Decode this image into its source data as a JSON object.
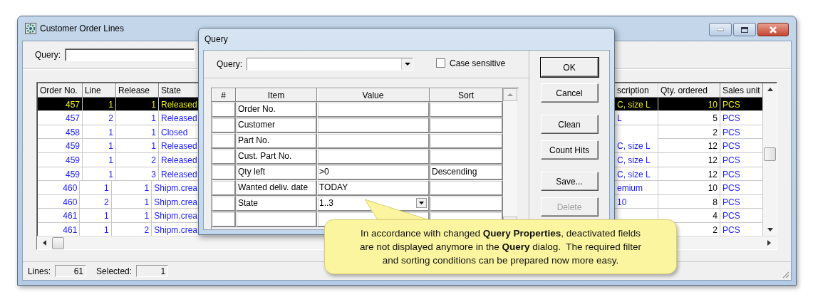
{
  "window": {
    "title": "Customer Order Lines"
  },
  "query_bar": {
    "label": "Query:"
  },
  "orders_table": {
    "left_columns": [
      "Order No.",
      "Line",
      "Release",
      "State"
    ],
    "right_columns": [
      "scription",
      "Qty. ordered",
      "Sales unit"
    ],
    "rows": [
      {
        "order_no": "457",
        "line": "1",
        "release": "1",
        "state": "Released",
        "description": "C, size L",
        "qty_ordered": "10",
        "sales_unit": "PCS",
        "selected": true
      },
      {
        "order_no": "457",
        "line": "2",
        "release": "1",
        "state": "Released",
        "description": "L",
        "qty_ordered": "5",
        "sales_unit": "PCS",
        "selected": false
      },
      {
        "order_no": "458",
        "line": "1",
        "release": "1",
        "state": "Closed",
        "qty_ordered": "2",
        "sales_unit": "PCS",
        "selected": false
      },
      {
        "order_no": "459",
        "line": "1",
        "release": "1",
        "state": "Released",
        "description": "C, size L",
        "qty_ordered": "12",
        "sales_unit": "PCS",
        "selected": false
      },
      {
        "order_no": "459",
        "line": "1",
        "release": "2",
        "state": "Released",
        "description": "C, size L",
        "qty_ordered": "12",
        "sales_unit": "PCS",
        "selected": false
      },
      {
        "order_no": "459",
        "line": "1",
        "release": "3",
        "state": "Released",
        "description": "C, size L",
        "qty_ordered": "12",
        "sales_unit": "PCS",
        "selected": false
      },
      {
        "order_no": "460",
        "line": "1",
        "release": "1",
        "state": "Shipm.crea",
        "description": "emium",
        "qty_ordered": "10",
        "sales_unit": "PCS",
        "selected": false
      },
      {
        "order_no": "460",
        "line": "2",
        "release": "1",
        "state": "Shipm.crea",
        "description": "10",
        "qty_ordered": "8",
        "sales_unit": "PCS",
        "selected": false
      },
      {
        "order_no": "461",
        "line": "1",
        "release": "1",
        "state": "Shipm.crea",
        "qty_ordered": "4",
        "sales_unit": "PCS",
        "selected": false
      },
      {
        "order_no": "461",
        "line": "1",
        "release": "2",
        "state": "Shipm.crea",
        "qty_ordered": "2",
        "sales_unit": "PCS",
        "selected": false
      }
    ]
  },
  "status_bar": {
    "lines_label": "Lines:",
    "lines": "61",
    "selected_label": "Selected:",
    "selected": "1"
  },
  "query_dialog": {
    "title": "Query",
    "query_label": "Query:",
    "case_sensitive": {
      "label": "Case sensitive",
      "checked": false
    },
    "columns": [
      "#",
      "Item",
      "Value",
      "Sort"
    ],
    "rows": [
      {
        "item": "Order No.",
        "dropdown": false
      },
      {
        "item": "Customer",
        "dropdown": false
      },
      {
        "item": "Part No.",
        "dropdown": false
      },
      {
        "item": "Cust. Part No.",
        "dropdown": false
      },
      {
        "item": "Qty left",
        "value": ">0",
        "sort": "Descending",
        "dropdown": false
      },
      {
        "item": "Wanted deliv. date",
        "value": "TODAY",
        "dropdown": false
      },
      {
        "item": "State",
        "value": "1..3",
        "dropdown": true
      },
      {
        "dropdown": false
      }
    ],
    "buttons": [
      {
        "label": "OK",
        "disabled": false
      },
      {
        "label": "Cancel",
        "disabled": false
      },
      {
        "label": "Clean",
        "disabled": false
      },
      {
        "label": "Count Hits",
        "disabled": false
      },
      {
        "label": "Save...",
        "disabled": false
      },
      {
        "label": "Delete",
        "disabled": true
      }
    ]
  },
  "callout": {
    "text": "In accordance with changed **Query Properties**, deactivated fields are not displayed anymore in the **Query** dialog.  The required filter and sorting conditions can be prepared now more easy."
  }
}
